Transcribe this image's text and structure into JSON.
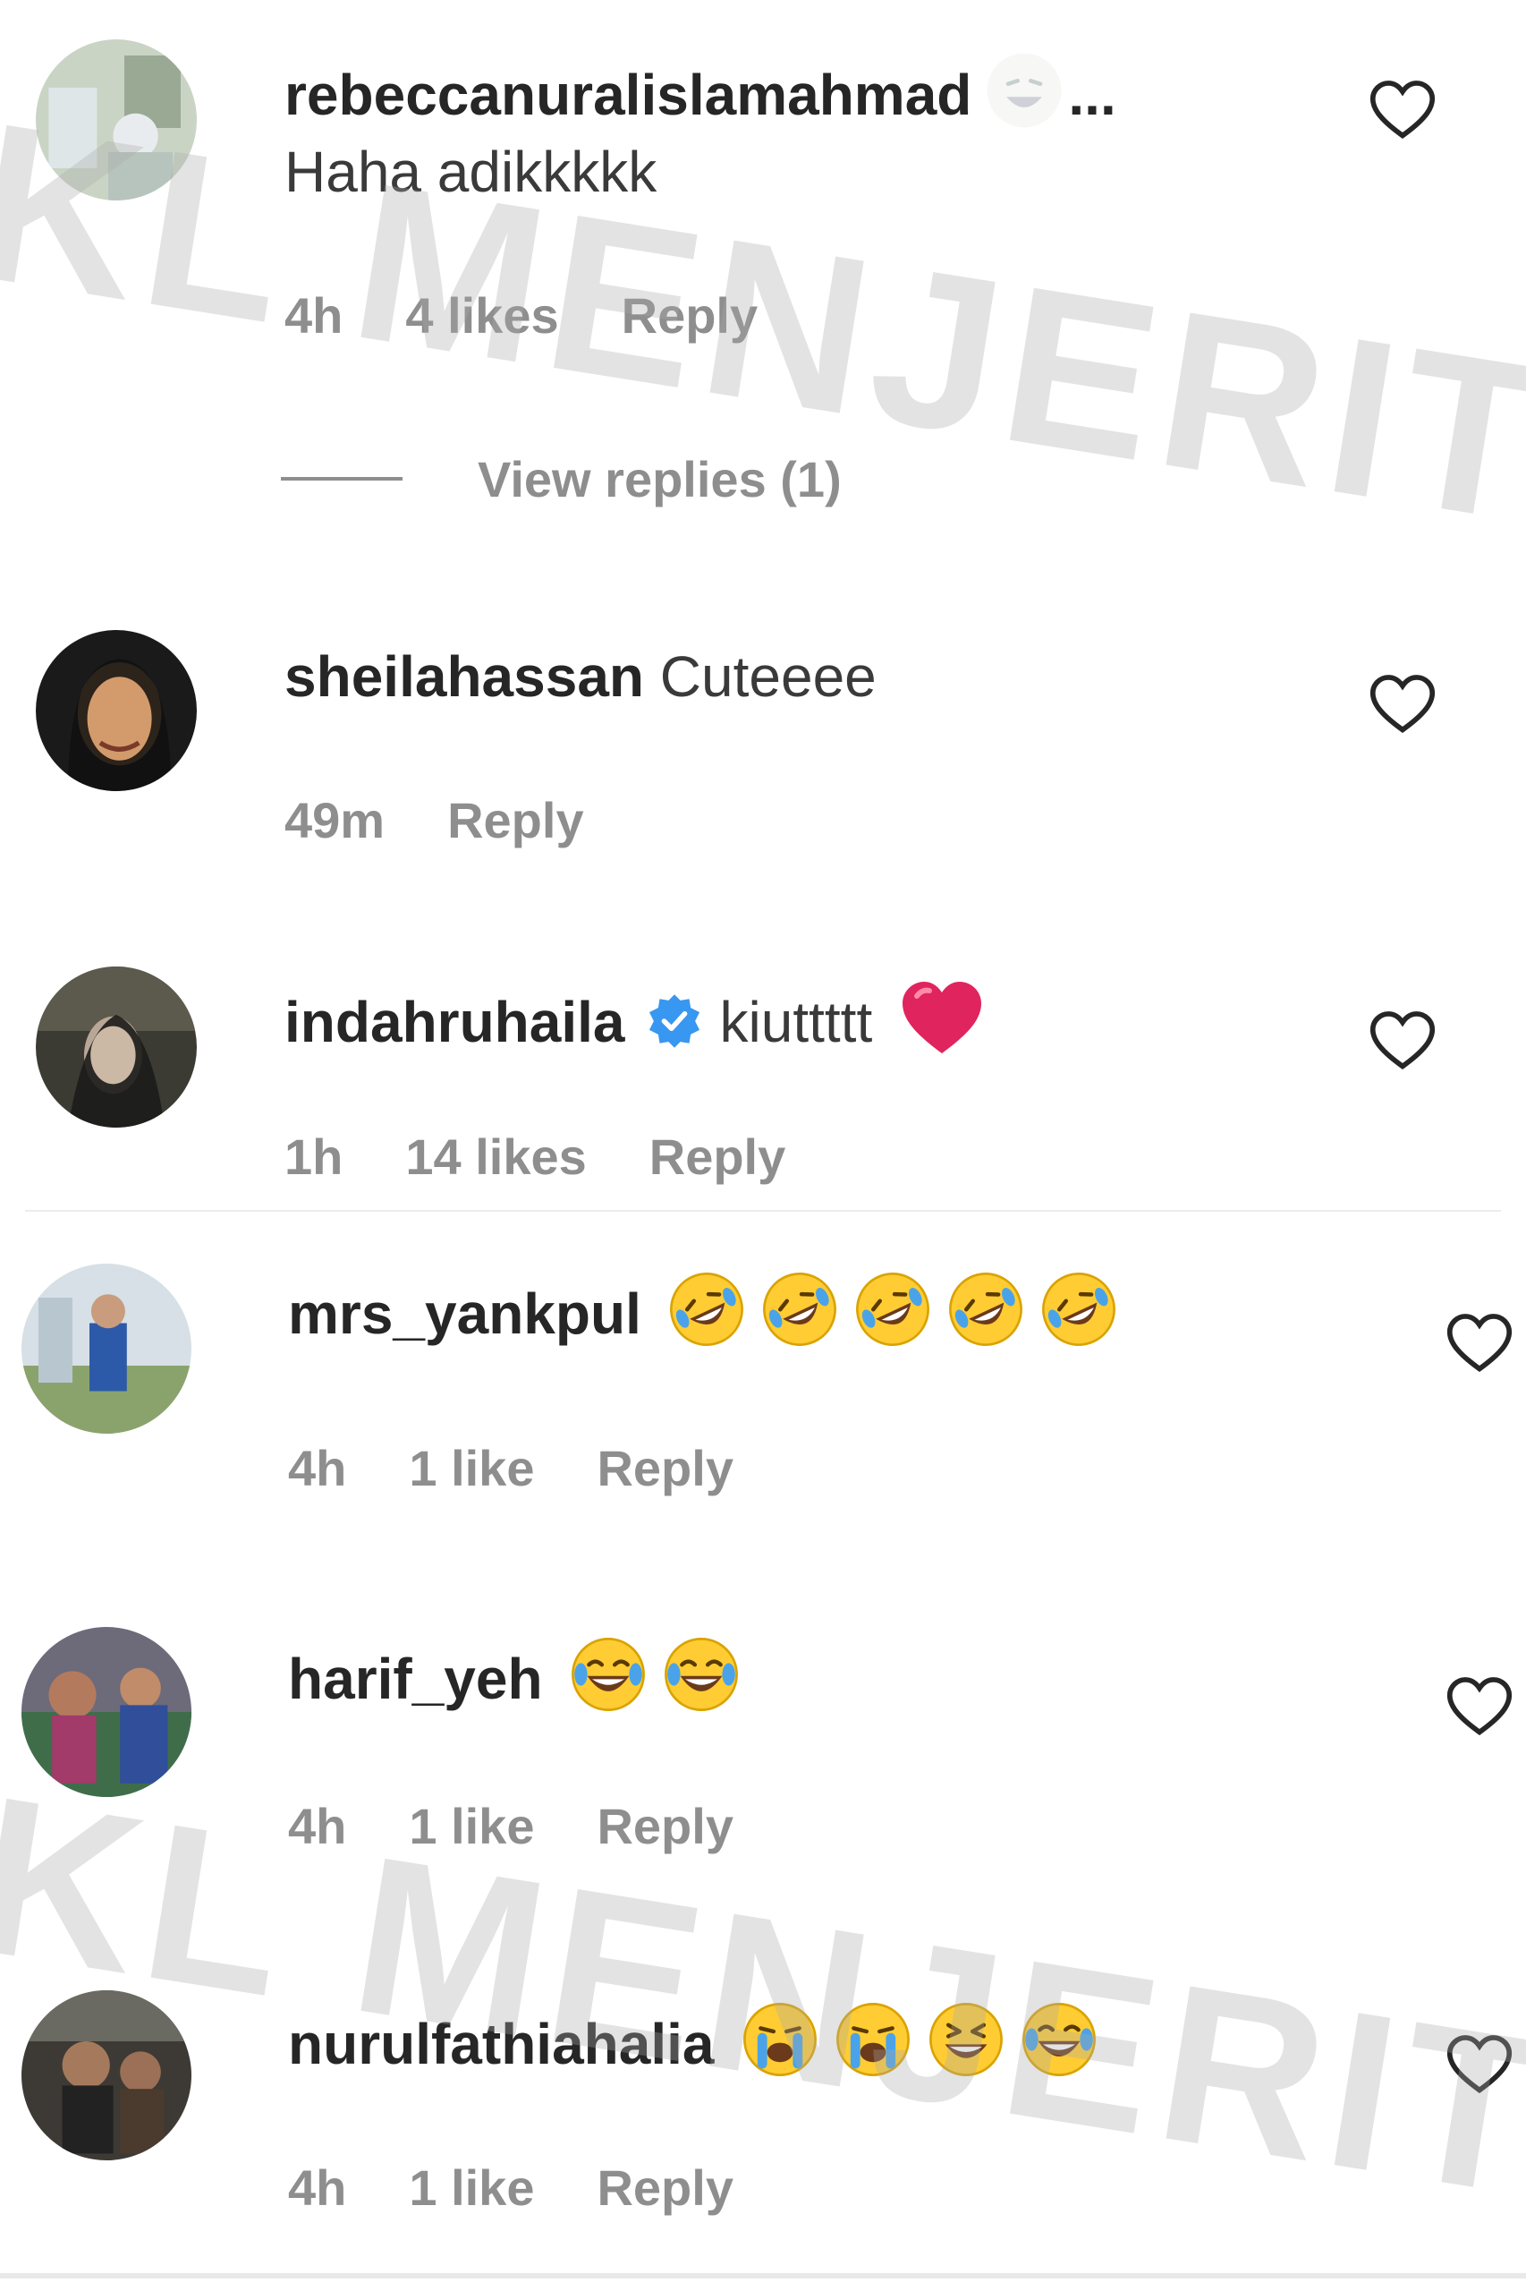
{
  "comments": [
    {
      "username": "rebeccanuralislamahmad",
      "text": "Haha adikkkkk",
      "time": "4h",
      "likes": "4 likes",
      "reply": "Reply",
      "truncated": "...",
      "view_replies": "View replies (1)"
    },
    {
      "username": "sheilahassan",
      "text": "Cuteeee",
      "time": "49m",
      "reply": "Reply"
    },
    {
      "username": "indahruhaila",
      "text": "kiuttttt",
      "verified": true,
      "time": "1h",
      "likes": "14 likes",
      "reply": "Reply"
    },
    {
      "username": "mrs_yankpul",
      "text": "",
      "emojis": [
        "rolling-on-floor-laughing",
        "rolling-on-floor-laughing",
        "rolling-on-floor-laughing",
        "rolling-on-floor-laughing",
        "rolling-on-floor-laughing"
      ],
      "time": "4h",
      "likes": "1 like",
      "reply": "Reply"
    },
    {
      "username": "harif_yeh",
      "text": "",
      "emojis": [
        "tears-of-joy",
        "tears-of-joy"
      ],
      "time": "4h",
      "likes": "1 like",
      "reply": "Reply"
    },
    {
      "username": "nurulfathiahalia",
      "text": "",
      "emojis": [
        "loudly-crying",
        "loudly-crying",
        "grinning-squinting",
        "tears-of-joy"
      ],
      "time": "4h",
      "likes": "1 like",
      "reply": "Reply"
    }
  ],
  "watermark": "KL MENJERIT",
  "colors": {
    "username": "#262626",
    "meta": "#8e8e8e",
    "verified": "#3897f0",
    "heart_filled": "#e0245e",
    "emoji_yellow": "#ffcc33",
    "tear_blue": "#4aa3e8"
  }
}
